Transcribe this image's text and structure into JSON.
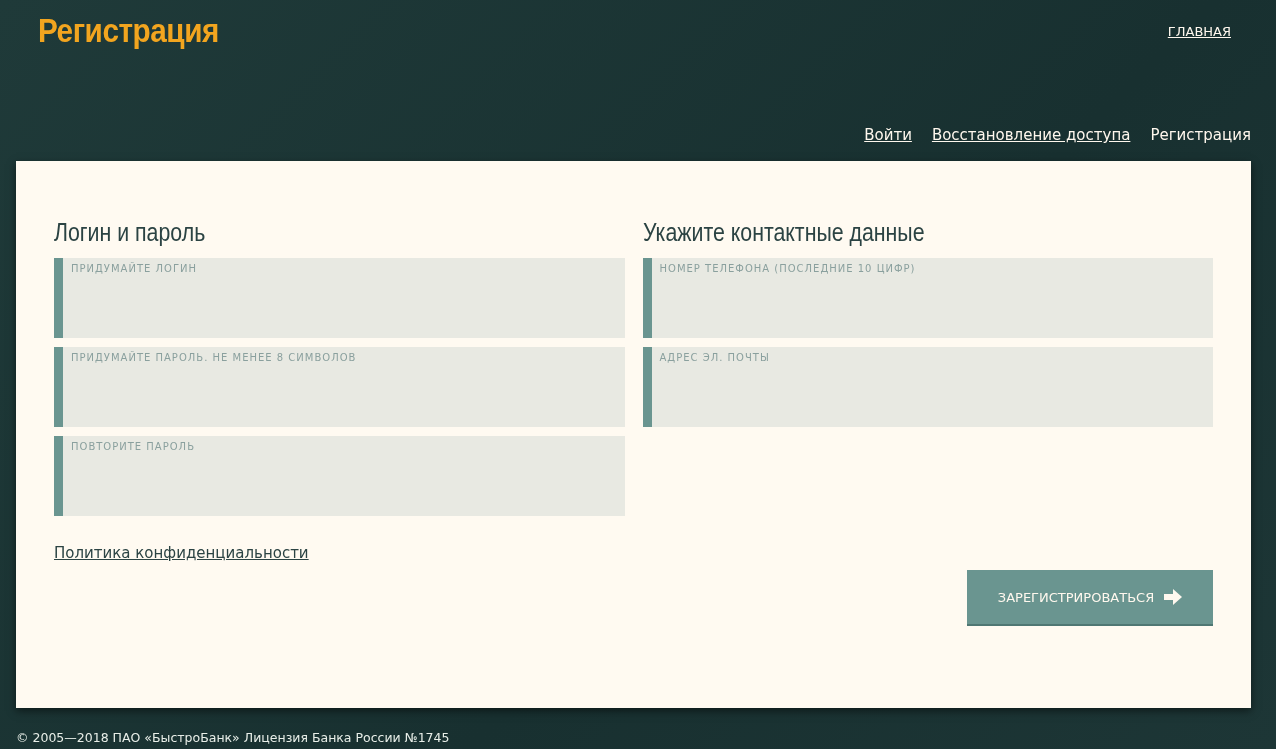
{
  "header": {
    "title": "Регистрация",
    "home_link": "ГЛАВНАЯ"
  },
  "nav": [
    {
      "label": "Войти",
      "selected": false
    },
    {
      "label": "Восстановление доступа",
      "selected": false
    },
    {
      "label": "Регистрация",
      "selected": true
    }
  ],
  "form": {
    "columns": [
      {
        "heading": "Логин и пароль",
        "fields": [
          {
            "placeholder": "ПРИДУМАЙТЕ ЛОГИН"
          },
          {
            "placeholder": "ПРИДУМАЙТЕ ПАРОЛЬ. НЕ МЕНЕЕ 8 СИМВОЛОВ"
          },
          {
            "placeholder": "ПОВТОРИТЕ ПАРОЛЬ"
          }
        ]
      },
      {
        "heading": "Укажите контактные данные",
        "fields": [
          {
            "placeholder": "НОМЕР ТЕЛЕФОНА (ПОСЛЕДНИЕ 10 ЦИФР)"
          },
          {
            "placeholder": "АДРЕС ЭЛ. ПОЧТЫ"
          }
        ]
      }
    ],
    "privacy_link": "Политика конфиденциальности",
    "submit": "ЗАРЕГИСТРИРОВАТЬСЯ"
  },
  "footer": "© 2005—2018 ПАО «БыстроБанк» Лицензия Банка России №1745"
}
